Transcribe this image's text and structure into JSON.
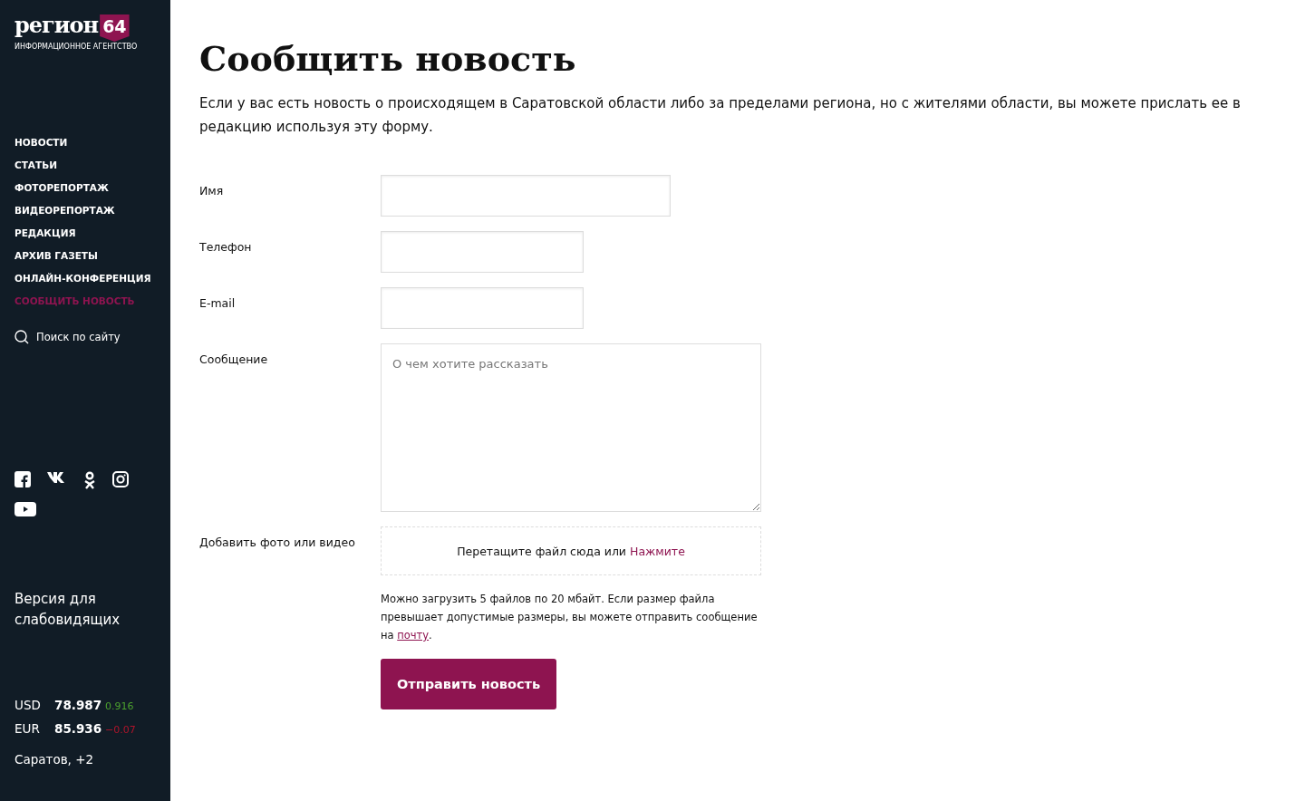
{
  "logo": {
    "name": "регион",
    "number": "64",
    "tagline": "ИНФОРМАЦИОННОЕ АГЕНТСТВО"
  },
  "nav": [
    {
      "label": "НОВОСТИ",
      "selected": false
    },
    {
      "label": "СТАТЬИ",
      "selected": false
    },
    {
      "label": "ФОТОРЕПОРТАЖ",
      "selected": false
    },
    {
      "label": "ВИДЕОРЕПОРТАЖ",
      "selected": false
    },
    {
      "label": "РЕДАКЦИЯ",
      "selected": false
    },
    {
      "label": "АРХИВ ГАЗЕТЫ",
      "selected": false
    },
    {
      "label": "ОНЛАЙН-КОНФЕРЕНЦИЯ",
      "selected": false
    },
    {
      "label": "СООБЩИТЬ НОВОСТЬ",
      "selected": true
    }
  ],
  "search": {
    "label": "Поиск по сайту"
  },
  "social": [
    {
      "kind": "facebook"
    },
    {
      "kind": "vk"
    },
    {
      "kind": "ok"
    },
    {
      "kind": "instagram"
    },
    {
      "kind": "youtube"
    }
  ],
  "accessibility": "Версия для слабовидящих",
  "rates": [
    {
      "currency": "USD",
      "value": "78.987",
      "change": "0.916",
      "color": "#4ca12e"
    },
    {
      "currency": "EUR",
      "value": "85.936",
      "change": "−0.07",
      "color": "#b0142b"
    }
  ],
  "weather": "Саратов, +2",
  "page": {
    "title": "Сообщить новость",
    "intro": "Если у вас есть новость о происходящем в Саратовской области либо за пределами региона, но с жителями области, вы можете прислать ее в редакцию используя эту форму."
  },
  "form": [
    {
      "kind": "wide-input",
      "label": "Имя"
    },
    {
      "kind": "input",
      "label": "Телефон"
    },
    {
      "kind": "input",
      "label": "E-mail"
    },
    {
      "kind": "textarea",
      "label": "Сообщение",
      "placeholder": "О чем хотите рассказать"
    },
    {
      "kind": "upload",
      "label": "Добавить фото или видео",
      "text": "Перетащите файл сюда или ",
      "link": "Нажмите"
    }
  ],
  "note": {
    "before": "Можно загрузить 5 файлов по 20 мбайт. Если размер файла превышает допустимые размеры, вы можете отправить сообщение на ",
    "link": "почту",
    "after": "."
  },
  "submit": "Отправить новость"
}
